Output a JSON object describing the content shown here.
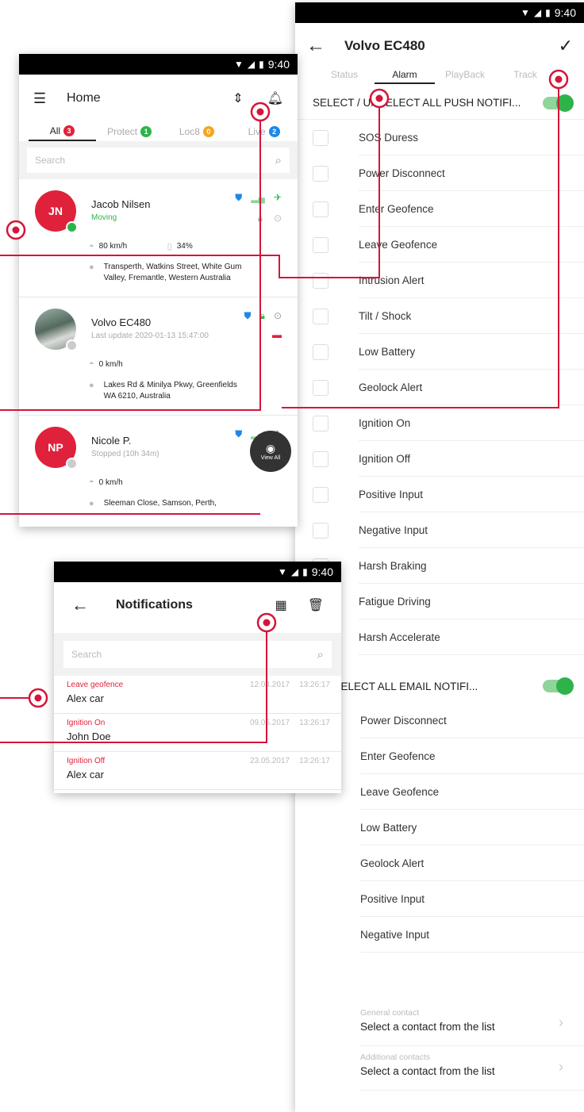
{
  "statusbar": {
    "time": "9:40"
  },
  "alarm_screen": {
    "title": "Volvo EC480",
    "tabs": [
      {
        "label": "Status",
        "active": false
      },
      {
        "label": "Alarm",
        "active": true
      },
      {
        "label": "PlayBack",
        "active": false
      },
      {
        "label": "Track",
        "active": false
      }
    ],
    "push_select_all": "SELECT / UNSELECT ALL PUSH NOTIFI...",
    "push_items": [
      "SOS Duress",
      "Power Disconnect",
      "Enter Geofence",
      "Leave Geofence",
      "Intrusion Alert",
      "Tilt / Shock",
      "Low Battery",
      "Geolock Alert",
      "Ignition On",
      "Ignition Off",
      "Positive Input",
      "Negative Input",
      "Harsh Braking",
      "Fatigue Driving",
      "Harsh Accelerate"
    ],
    "email_select_all": "CT / UNSELECT ALL EMAIL NOTIFI...",
    "email_items": [
      "Power Disconnect",
      "Enter Geofence",
      "Leave Geofence",
      "Low Battery",
      "Geolock Alert",
      "Positive Input",
      "Negative Input"
    ],
    "contacts": [
      {
        "label": "General contact",
        "value": "Select a contact from the list"
      },
      {
        "label": "Additional contacts",
        "value": "Select a contact from the list"
      }
    ]
  },
  "home_screen": {
    "title": "Home",
    "tabs": [
      {
        "label": "All",
        "count": "3",
        "color": "#e0213b",
        "active": true
      },
      {
        "label": "Protect",
        "count": "1",
        "color": "#2eb34a",
        "active": false
      },
      {
        "label": "Loc8",
        "count": "0",
        "color": "#f5a623",
        "active": false
      },
      {
        "label": "Live",
        "count": "2",
        "color": "#1e88e5",
        "active": false
      }
    ],
    "search_placeholder": "Search",
    "vehicles": [
      {
        "initials": "JN",
        "name": "Jacob Nilsen",
        "status": "Moving",
        "status_color": "#2eb34a",
        "speed": "80 km/h",
        "battery": "34%",
        "address": "Transperth, Watkins Street, White Gum",
        "address2": "Valley, Fremantle, Western Australia",
        "online": true
      },
      {
        "initials": "",
        "name": "Volvo EC480",
        "status": "Last update 2020-01-13 15:47:00",
        "status_color": "#aaaaaa",
        "speed": "0 km/h",
        "address": "Lakes Rd & Minilya Pkwy, Greenfields",
        "address2": "WA 6210, Australia",
        "online": false
      },
      {
        "initials": "NP",
        "name": "Nicole P.",
        "status": "Stopped (10h 34m)",
        "status_color": "#aaaaaa",
        "speed": "0 km/h",
        "address": "Sleeman Close, Samson, Perth,",
        "address2": "",
        "online": false
      }
    ],
    "fab_label": "View All"
  },
  "notifications_screen": {
    "title": "Notifications",
    "search_placeholder": "Search",
    "items": [
      {
        "event": "Leave geofence",
        "who": "Alex car",
        "date": "12.04.2017",
        "time": "13:26:17"
      },
      {
        "event": "Ignition On",
        "who": "John Doe",
        "date": "09.05.2017",
        "time": "13:26:17"
      },
      {
        "event": "Ignition Off",
        "who": "Alex car",
        "date": "23.05.2017",
        "time": "13:26:17"
      }
    ]
  },
  "colors": {
    "accent": "#e0213b",
    "green": "#2eb34a",
    "callout": "#d5153a"
  }
}
